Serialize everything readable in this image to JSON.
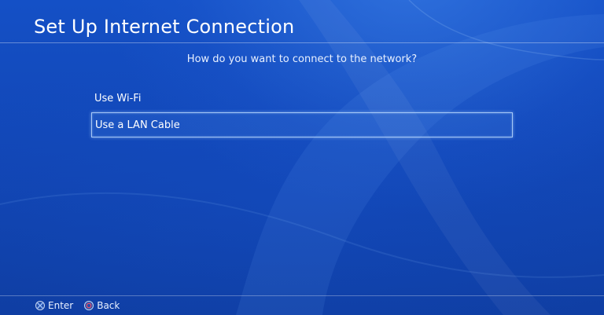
{
  "header": {
    "title": "Set Up Internet Connection"
  },
  "main": {
    "prompt": "How do you want to connect to the network?",
    "options": [
      {
        "label": "Use Wi-Fi",
        "selected": false
      },
      {
        "label": "Use a LAN Cable",
        "selected": true
      }
    ]
  },
  "footer": {
    "enter_label": "Enter",
    "enter_icon": "cross-button-icon",
    "back_label": "Back",
    "back_icon": "circle-button-icon"
  },
  "colors": {
    "background": "#1247b7",
    "focus_border": "#bedcff",
    "circle_button_accent": "#e0506a"
  }
}
